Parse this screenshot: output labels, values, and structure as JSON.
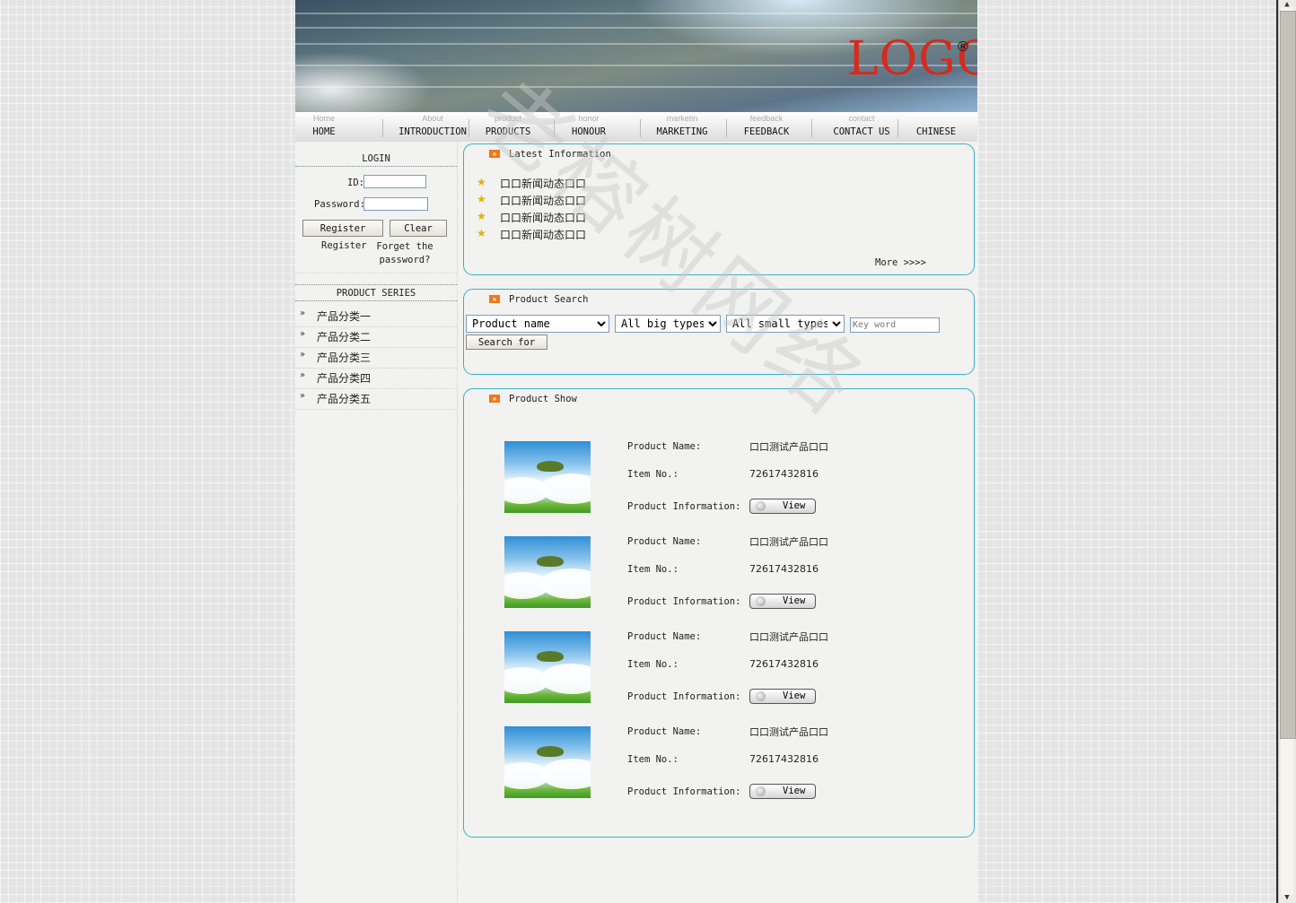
{
  "header": {
    "logo_text": "LOGO",
    "logo_mark": "®"
  },
  "nav": [
    {
      "sub": "Home",
      "main": "HOME"
    },
    {
      "sub": "About",
      "main": "INTRODUCTION"
    },
    {
      "sub": "product",
      "main": "PRODUCTS"
    },
    {
      "sub": "honor",
      "main": "HONOUR"
    },
    {
      "sub": "marketin",
      "main": "MARKETING"
    },
    {
      "sub": "feedback",
      "main": "FEEDBACK"
    },
    {
      "sub": "contact",
      "main": "CONTACT US"
    },
    {
      "sub": "",
      "main": "CHINESE"
    }
  ],
  "login": {
    "title": "LOGIN",
    "id_label": "ID:",
    "password_label": "Password:",
    "register_button": "Register",
    "clear_button": "Clear",
    "register_link": "Register",
    "forgot_link": "Forget the password?"
  },
  "product_series": {
    "title": "PRODUCT SERIES",
    "items": [
      "产品分类一",
      "产品分类二",
      "产品分类三",
      "产品分类四",
      "产品分类五"
    ]
  },
  "latest": {
    "title": "Latest Information",
    "items": [
      "口口新闻动态口口",
      "口口新闻动态口口",
      "口口新闻动态口口",
      "口口新闻动态口口"
    ],
    "more": "More >>>>"
  },
  "search": {
    "title": "Product Search",
    "field_select": "Product name",
    "big_type_select": "All big types",
    "small_type_select": "All small types",
    "keyword_placeholder": "Key word",
    "search_button": "Search for"
  },
  "show": {
    "title": "Product Show",
    "name_label": "Product Name:",
    "item_label": "Item No.:",
    "info_label": "Product Information:",
    "view_button": "View",
    "products": [
      {
        "name": "口口测试产品口口",
        "item_no": "72617432816"
      },
      {
        "name": "口口测试产品口口",
        "item_no": "72617432816"
      },
      {
        "name": "口口测试产品口口",
        "item_no": "72617432816"
      },
      {
        "name": "口口测试产品口口",
        "item_no": "72617432816"
      }
    ]
  },
  "watermark": "老榕树网络"
}
